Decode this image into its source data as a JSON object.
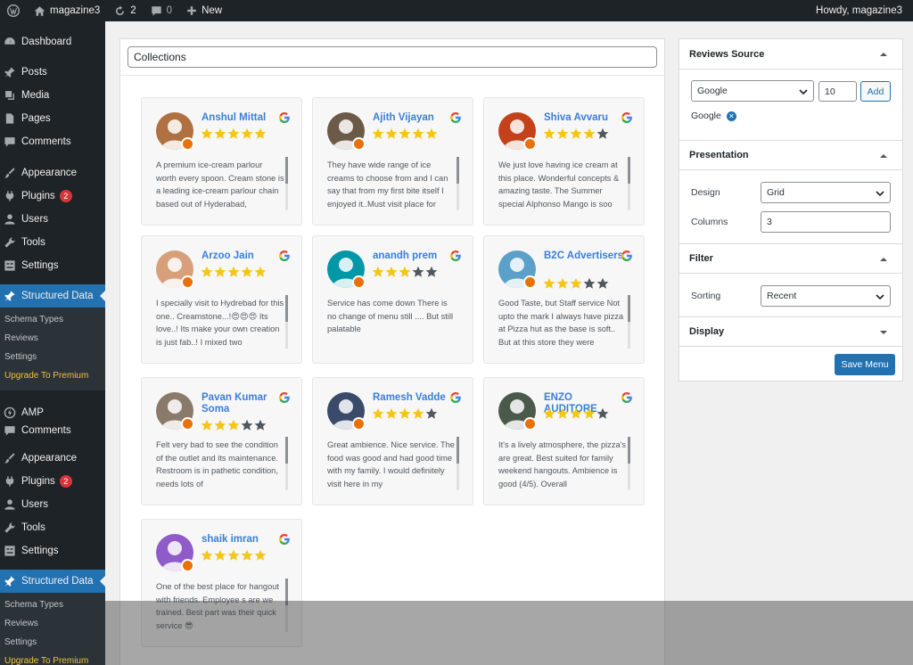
{
  "admin_bar": {
    "site_name": "magazine3",
    "updates_count": "2",
    "comments_count": "0",
    "new_label": "New",
    "howdy": "Howdy, magazine3"
  },
  "sidebar": {
    "items": [
      {
        "label": "Dashboard",
        "icon": "dashboard-icon"
      },
      {
        "label": "Posts",
        "icon": "pin-icon"
      },
      {
        "label": "Media",
        "icon": "media-icon"
      },
      {
        "label": "Pages",
        "icon": "pages-icon"
      },
      {
        "label": "Comments",
        "icon": "comment-icon"
      },
      {
        "label": "Appearance",
        "icon": "brush-icon"
      },
      {
        "label": "Plugins",
        "icon": "plugin-icon",
        "badge": "2"
      },
      {
        "label": "Users",
        "icon": "users-icon"
      },
      {
        "label": "Tools",
        "icon": "tools-icon"
      },
      {
        "label": "Settings",
        "icon": "settings-icon"
      },
      {
        "label": "Structured Data",
        "icon": "pin-icon"
      }
    ],
    "submenu": [
      "Schema Types",
      "Reviews",
      "Settings",
      "Upgrade To Premium"
    ],
    "items2": [
      {
        "label": "AMP",
        "icon": "amp-icon"
      },
      {
        "label": "Comments",
        "icon": "comment-icon"
      },
      {
        "label": "Appearance",
        "icon": "brush-icon"
      },
      {
        "label": "Plugins",
        "icon": "plugin-icon",
        "badge": "2"
      },
      {
        "label": "Users",
        "icon": "users-icon"
      },
      {
        "label": "Tools",
        "icon": "tools-icon"
      },
      {
        "label": "Settings",
        "icon": "settings-icon"
      },
      {
        "label": "Structured Data",
        "icon": "pin-icon"
      }
    ],
    "submenu2": [
      "Schema Types",
      "Reviews",
      "Settings",
      "Upgrade To Premium"
    ]
  },
  "main": {
    "collection_title": "Collections",
    "reviews": [
      {
        "name": "Anshul Mittal",
        "rating": 5,
        "text": "A premium ice-cream parlour worth every spoon. Cream stone is a leading ice-cream parlour chain based out of Hyderabad,",
        "avatar_color": "#b07040"
      },
      {
        "name": "Ajith Vijayan",
        "rating": 5,
        "text": "They have wide range of ice creams to choose from and I can say that from my first bite itself I enjoyed it..Must visit place for",
        "avatar_color": "#6b5a48"
      },
      {
        "name": "Shiva Avvaru",
        "rating": 4,
        "text": "We just love having ice cream at this place. Wonderful concepts & amazing taste. The Summer special Alphonso Mango is soo",
        "avatar_color": "#c4421a"
      },
      {
        "name": "Arzoo Jain",
        "rating": 5,
        "text": "I specially visit to Hydrebad for this one.. Creamstone...!😍😍😍 Its love..! Its make your own creation is just fab..! I mixed two",
        "avatar_color": "#d8a07a"
      },
      {
        "name": "anandh prem",
        "rating": 3,
        "text": "Service has come down There is no change of menu still .... But still palatable",
        "avatar_color": "#0097a7"
      },
      {
        "name": "B2C Advertisers",
        "rating": 3,
        "text": "Good Taste, but Staff service Not upto the mark I always have pizza at Pizza hut as the base is soft.. But at this store they were",
        "avatar_color": "#5aa0c8"
      },
      {
        "name": "Pavan Kumar Soma",
        "rating": 3,
        "text": "Felt very bad to see the condition of the outlet and its maintenance. Restroom is in pathetic condition, needs lots of",
        "avatar_color": "#8a7a6a"
      },
      {
        "name": "Ramesh Vadde",
        "rating": 4,
        "text": "Great ambience. Nice service. The food was good and had good time with my family. I would definitely visit here in my",
        "avatar_color": "#3a4a6a"
      },
      {
        "name": "ENZO AUDITORE",
        "rating": 4,
        "text": "It's a lively atmosphere, the pizza's are great. Best suited for family weekend hangouts. Ambience is good (4/5). Overall",
        "avatar_color": "#4a5a4a"
      },
      {
        "name": "shaik imran",
        "rating": 5,
        "text": "One of the best place for hangout with friends. Employee s are we trained. Best part was their quick service 😎",
        "avatar_color": "#8e5bc8"
      }
    ]
  },
  "right_panel": {
    "reviews_source": {
      "title": "Reviews Source",
      "source_select": "Google",
      "count_value": "10",
      "add_label": "Add",
      "added_source": "Google"
    },
    "presentation": {
      "title": "Presentation",
      "design_label": "Design",
      "design_value": "Grid",
      "columns_label": "Columns",
      "columns_value": "3"
    },
    "filter": {
      "title": "Filter",
      "sorting_label": "Sorting",
      "sorting_value": "Recent"
    },
    "display": {
      "title": "Display"
    },
    "save_label": "Save Menu"
  }
}
